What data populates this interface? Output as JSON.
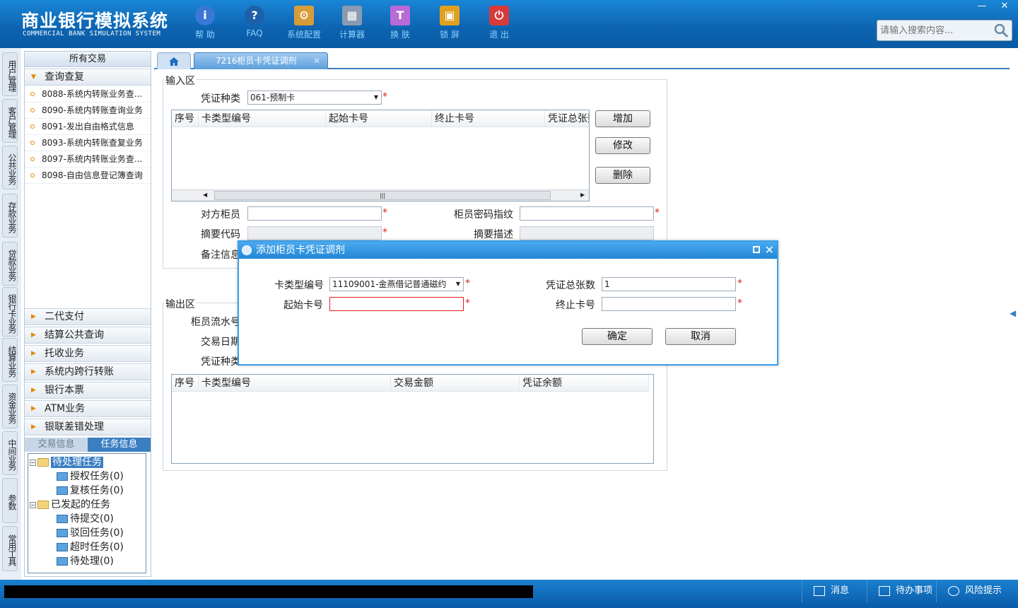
{
  "header": {
    "logo_cn": "商业银行模拟系统",
    "logo_en": "COMMERCIAL BANK SIMULATION SYSTEM",
    "toolbar": [
      {
        "label": "帮 助",
        "icon": "info-icon",
        "glyph": "i",
        "color": "#3a78d8"
      },
      {
        "label": "FAQ",
        "icon": "faq-icon",
        "glyph": "?",
        "color": "#2a6fb8"
      },
      {
        "label": "系统配置",
        "icon": "toolbox-icon",
        "glyph": "⚙",
        "color": "#d89b3a"
      },
      {
        "label": "计算器",
        "icon": "calculator-icon",
        "glyph": "▦",
        "color": "#8a9ab0"
      },
      {
        "label": "换 肤",
        "icon": "tshirt-icon",
        "glyph": "👕",
        "color": "#b86ad8"
      },
      {
        "label": "锁 屏",
        "icon": "lock-icon",
        "glyph": "🔒",
        "color": "#e0a020"
      },
      {
        "label": "退 出",
        "icon": "power-icon",
        "glyph": "⏻",
        "color": "#d83a3a"
      }
    ],
    "search_placeholder": "请输入搜索内容..."
  },
  "vtabs": [
    "用户管理",
    "客户管理",
    "公共业务",
    "存款业务",
    "贷款业务",
    "银行卡业务",
    "结算业务",
    "资金业务",
    "中间业务",
    "参数",
    "常用工具"
  ],
  "left_menu": {
    "title": "所有交易",
    "open_group": "查询查复",
    "items": [
      "8088-系统内转账业务查...",
      "8090-系统内转账查询业务",
      "8091-发出自由格式信息",
      "8093-系统内转账查复业务",
      "8097-系统内转账业务查...",
      "8098-自由信息登记簿查询"
    ],
    "groups": [
      "二代支付",
      "结算公共查询",
      "托收业务",
      "系统内跨行转账",
      "银行本票",
      "ATM业务",
      "银联差错处理"
    ],
    "tabs": {
      "trans": "交易信息",
      "task": "任务信息"
    },
    "tree": [
      {
        "label": "待处理任务",
        "level": 0
      },
      {
        "label": "授权任务(0)",
        "level": 1
      },
      {
        "label": "复核任务(0)",
        "level": 1
      },
      {
        "label": "已发起的任务",
        "level": 0
      },
      {
        "label": "待提交(0)",
        "level": 1
      },
      {
        "label": "驳回任务(0)",
        "level": 1
      },
      {
        "label": "超时任务(0)",
        "level": 1
      },
      {
        "label": "待处理(0)",
        "level": 1
      }
    ]
  },
  "tabs": {
    "active": "7216柜员卡凭证调剂"
  },
  "form": {
    "input_legend": "输入区",
    "voucher_type_label": "凭证种类",
    "voucher_type_value": "061-预制卡",
    "grid_cols": [
      "序号",
      "卡类型编号",
      "起始卡号",
      "终止卡号",
      "凭证总张数"
    ],
    "btn_add": "增加",
    "btn_edit": "修改",
    "btn_delete": "删除",
    "peer_teller_label": "对方柜员",
    "teller_pwd_label": "柜员密码指纹",
    "summary_code_label": "摘要代码",
    "summary_desc_label": "摘要描述",
    "remark_label": "备注信息",
    "output_legend": "输出区",
    "serial_label": "柜员流水号",
    "date_label": "交易日期",
    "voucher_type2_label": "凭证种类",
    "out_cols": [
      "序号",
      "卡类型编号",
      "交易金额",
      "凭证余额"
    ]
  },
  "dialog": {
    "title": "添加柜员卡凭证调剂",
    "card_type_label": "卡类型编号",
    "card_type_value": "11109001-金燕借记普通磁约",
    "total_label": "凭证总张数",
    "total_value": "1",
    "start_label": "起始卡号",
    "start_value": "",
    "end_label": "终止卡号",
    "end_value": "",
    "ok": "确定",
    "cancel": "取消"
  },
  "statusbar": {
    "msg": "消息",
    "todo": "待办事项",
    "risk": "风险提示"
  }
}
